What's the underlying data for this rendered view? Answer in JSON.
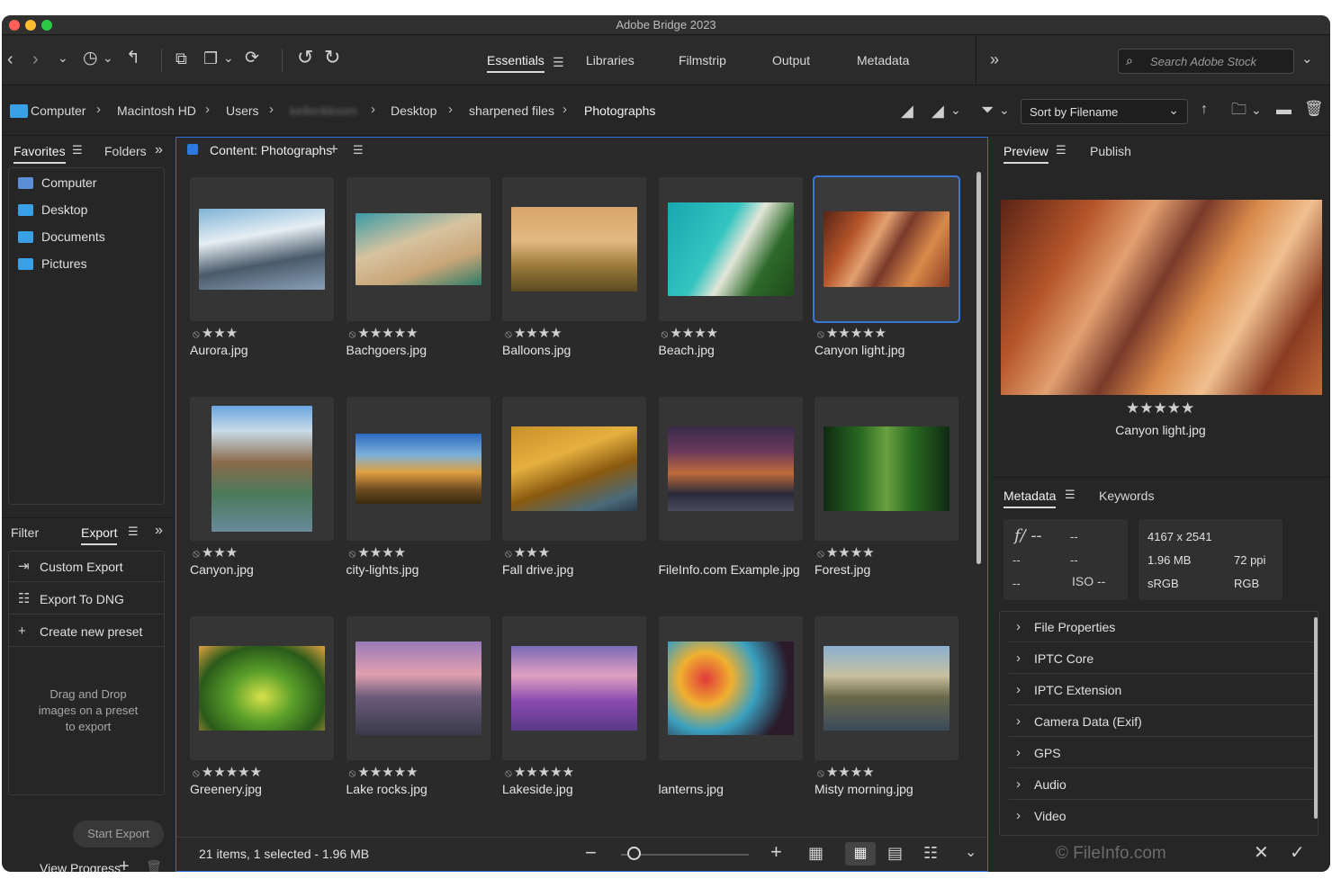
{
  "window": {
    "title": "Adobe Bridge 2023"
  },
  "toolbar": {
    "workspaces": [
      {
        "label": "Essentials",
        "active": true
      },
      {
        "label": "Libraries"
      },
      {
        "label": "Filmstrip"
      },
      {
        "label": "Output"
      },
      {
        "label": "Metadata"
      }
    ],
    "more_glyph": "»",
    "search_placeholder": "Search Adobe Stock"
  },
  "breadcrumb": [
    "Computer",
    "Macintosh HD",
    "Users",
    "kellenbloom",
    "Desktop",
    "sharpened files",
    "Photographs"
  ],
  "sort": {
    "label": "Sort by Filename"
  },
  "favorites": {
    "tabs": {
      "favorites": "Favorites",
      "folders": "Folders"
    },
    "items": [
      "Computer",
      "Desktop",
      "Documents",
      "Pictures"
    ]
  },
  "export": {
    "tabs": {
      "filter": "Filter",
      "export": "Export"
    },
    "items": [
      "Custom Export",
      "Export To DNG",
      "Create new preset"
    ],
    "drop_hint": "Drag and Drop images on a preset to export",
    "start_button": "Start Export",
    "view_progress": "View Progress"
  },
  "content": {
    "title": "Content: Photographs",
    "status": "21 items, 1 selected - 1.96 MB",
    "items": [
      {
        "name": "Aurora.jpg",
        "stars": 3,
        "selected": false
      },
      {
        "name": "Bachgoers.jpg",
        "stars": 5,
        "selected": false
      },
      {
        "name": "Balloons.jpg",
        "stars": 4,
        "selected": false
      },
      {
        "name": "Beach.jpg",
        "stars": 4,
        "selected": false
      },
      {
        "name": "Canyon light.jpg",
        "stars": 5,
        "selected": true
      },
      {
        "name": "Canyon.jpg",
        "stars": 3,
        "selected": false
      },
      {
        "name": "city-lights.jpg",
        "stars": 4,
        "selected": false
      },
      {
        "name": "Fall drive.jpg",
        "stars": 3,
        "selected": false
      },
      {
        "name": "FileInfo.com Example.jpg",
        "stars": 0,
        "selected": false
      },
      {
        "name": "Forest.jpg",
        "stars": 4,
        "selected": false
      },
      {
        "name": "Greenery.jpg",
        "stars": 5,
        "selected": false
      },
      {
        "name": "Lake rocks.jpg",
        "stars": 5,
        "selected": false
      },
      {
        "name": "Lakeside.jpg",
        "stars": 5,
        "selected": false
      },
      {
        "name": "lanterns.jpg",
        "stars": 0,
        "selected": false
      },
      {
        "name": "Misty morning.jpg",
        "stars": 4,
        "selected": false
      }
    ]
  },
  "preview": {
    "tabs": {
      "preview": "Preview",
      "publish": "Publish"
    },
    "filename": "Canyon light.jpg",
    "stars": 5
  },
  "metadata": {
    "tabs": {
      "metadata": "Metadata",
      "keywords": "Keywords"
    },
    "camera": {
      "aperture": "f/ --",
      "shutter": "--",
      "a": "--",
      "b": "--",
      "c": "--",
      "iso": "ISO --"
    },
    "file": {
      "dimensions": "4167 x 2541",
      "size": "1.96 MB",
      "resolution": "72 ppi",
      "profile": "sRGB",
      "mode": "RGB"
    },
    "sections": [
      "File Properties",
      "IPTC Core",
      "IPTC Extension",
      "Camera Data (Exif)",
      "GPS",
      "Audio",
      "Video"
    ],
    "watermark": "© FileInfo.com"
  },
  "colors": {
    "accent": "#3a78d8",
    "folder": "#3aa0e6"
  }
}
